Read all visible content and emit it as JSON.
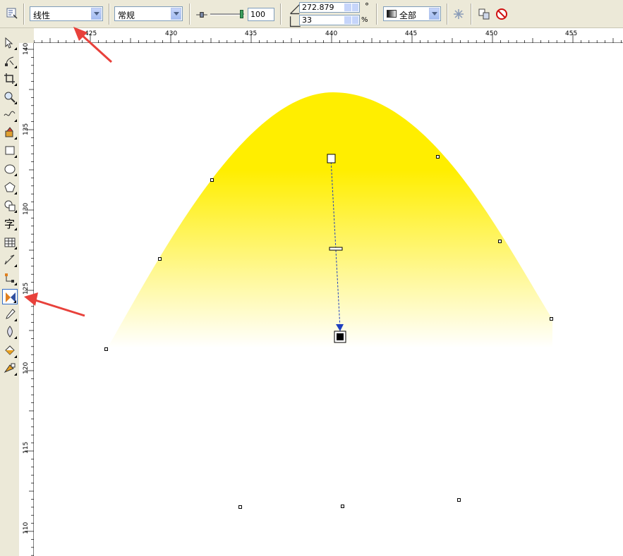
{
  "propbar": {
    "fill_type": "线性",
    "fill_mode": "常规",
    "midpoint": "100",
    "angle": "272.879",
    "edge_pad": "33",
    "angle_unit": "°",
    "pad_unit": "%",
    "apply_scope": "全部"
  },
  "ruler_top": [
    "425",
    "430",
    "435",
    "440",
    "445",
    "450",
    "455"
  ],
  "ruler_left": [
    "140",
    "135",
    "130",
    "125",
    "120",
    "115",
    "110"
  ],
  "toolbox": [
    {
      "name": "pick-tool-icon"
    },
    {
      "name": "shape-tool-icon"
    },
    {
      "name": "crop-tool-icon"
    },
    {
      "name": "zoom-tool-icon"
    },
    {
      "name": "freehand-tool-icon"
    },
    {
      "name": "smart-fill-tool-icon"
    },
    {
      "name": "rectangle-tool-icon"
    },
    {
      "name": "ellipse-tool-icon"
    },
    {
      "name": "polygon-tool-icon"
    },
    {
      "name": "basic-shapes-tool-icon"
    },
    {
      "name": "text-tool-icon",
      "glyph": "字"
    },
    {
      "name": "table-tool-icon"
    },
    {
      "name": "dimension-tool-icon"
    },
    {
      "name": "connector-tool-icon"
    },
    {
      "name": "interactive-blend-tool-icon"
    },
    {
      "name": "eyedropper-tool-icon"
    },
    {
      "name": "outline-tool-icon"
    },
    {
      "name": "fill-tool-icon"
    },
    {
      "name": "interactive-fill-tool-icon"
    }
  ],
  "colors": {
    "gradient_start": "#ffee00",
    "gradient_end": "#ffffff",
    "annotation_arrow": "#e8413b",
    "vector_line": "#1f3fbf"
  }
}
